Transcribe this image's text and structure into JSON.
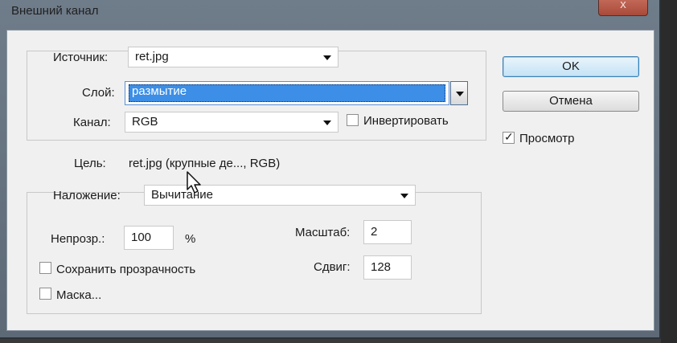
{
  "dialog": {
    "title": "Внешний канал",
    "close_label": "x"
  },
  "source": {
    "label": "Источник:",
    "file": "ret.jpg",
    "layer_label": "Слой:",
    "layer": "размытие",
    "channel_label": "Канал:",
    "channel": "RGB",
    "invert_label": "Инвертировать",
    "invert_checked": false
  },
  "target": {
    "label": "Цель:",
    "value": "ret.jpg (крупные  де..., RGB)"
  },
  "blending": {
    "label": "Наложение:",
    "mode": "Вычитание",
    "opacity_label": "Непрозр.:",
    "opacity": "100",
    "opacity_unit": "%",
    "preserve_label": "Сохранить прозрачность",
    "preserve_checked": false,
    "mask_label": "Маска...",
    "mask_checked": false,
    "scale_label": "Масштаб:",
    "scale": "2",
    "offset_label": "Сдвиг:",
    "offset": "128"
  },
  "buttons": {
    "ok": "OK",
    "cancel": "Отмена"
  },
  "preview": {
    "label": "Просмотр",
    "checked": true
  }
}
